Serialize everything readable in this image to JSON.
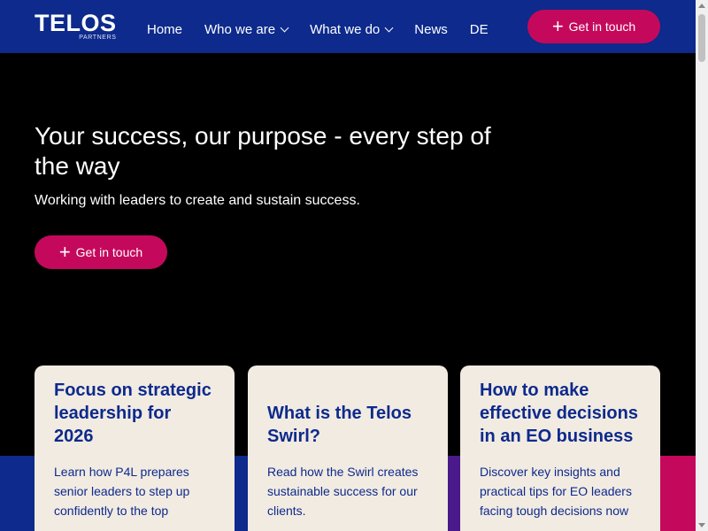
{
  "header": {
    "logo_main": "TELOS",
    "logo_sub": "PARTNERS",
    "nav": [
      {
        "label": "Home",
        "has_dropdown": false
      },
      {
        "label": "Who we are",
        "has_dropdown": true
      },
      {
        "label": "What we do",
        "has_dropdown": true
      },
      {
        "label": "News",
        "has_dropdown": false
      },
      {
        "label": "DE",
        "has_dropdown": false
      }
    ],
    "cta_label": "Get in touch",
    "cta_icon": "plus-icon"
  },
  "hero": {
    "title": "Your success, our purpose - every step of the way",
    "subtitle": "Working with leaders to create and sustain success.",
    "cta_label": "Get in touch",
    "cta_icon": "plus-icon"
  },
  "cards": [
    {
      "title": "Focus on strategic leadership for 2026",
      "text": "Learn how P4L prepares senior leaders to step up confidently to the top"
    },
    {
      "title": "What is the Telos Swirl?",
      "text": "Read how the Swirl creates sustainable success for our clients."
    },
    {
      "title": "How to make effective decisions in an EO business",
      "text": "Discover key insights and practical tips for EO leaders facing tough decisions now"
    }
  ],
  "colors": {
    "brand_blue": "#0d2a8c",
    "accent_pink": "#c4095c",
    "purple": "#4a1a8a",
    "card_bg": "#f2ebe2"
  }
}
